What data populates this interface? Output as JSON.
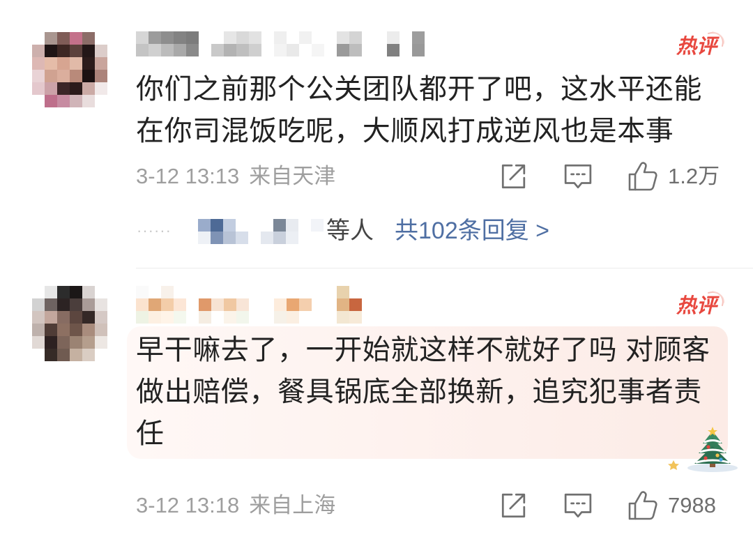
{
  "colors": {
    "text": "#222222",
    "meta": "#9e9e9e",
    "count": "#6e6e6e",
    "link": "#4f6fa3",
    "badge": "#e8483f",
    "divider": "#ececec",
    "icon": "#707070",
    "reply-suffix": "#444444",
    "ellipsis": "#c9c9c9",
    "panel-left": "#fff8f6",
    "panel-right": "#fcebe6"
  },
  "comments": [
    {
      "user": {
        "avatar_mosaic": [
          [
            "",
            "#a99690",
            "#7f5c57",
            "#c4718a",
            "#8c6d68",
            ""
          ],
          [
            "#cdb0ad",
            "#1f1515",
            "#3d2723",
            "#5c413c",
            "#231717",
            "#dccdca"
          ],
          [
            "#ddb8b4",
            "#e5bca8",
            "#d7a591",
            "#e1baa8",
            "#2c1c1b",
            "#c9a59c"
          ],
          [
            "#e9d3d6",
            "#d0a291",
            "#dbae9d",
            "#b98a7a",
            "#1b1111",
            "#ab837a"
          ],
          [
            "#e4c8cd",
            "#cca2a8",
            "#3c2527",
            "#2b1b1b",
            "#cbaaa5",
            "#f1e9e9"
          ],
          [
            "",
            "#be6f8b",
            "#c78ba1",
            "#d0b4b8",
            "#e9dddd",
            ""
          ]
        ],
        "name_mosaic": [
          [
            "#d6d6d6",
            "#9c9c9c",
            "#8e8e8e",
            "#838383",
            "#7c7c7c",
            "#ffffff",
            "#ffffff",
            "#e6e6e6",
            "#d9d9d9",
            "#e2e2e2",
            "#ffffff",
            "#efefef",
            "#ffffff",
            "#f1f1f1",
            "#ffffff",
            "#ffffff",
            "#e3e3e3",
            "#d4d4d4",
            "#ffffff",
            "#ffffff",
            "#ececec",
            "#ffffff",
            "#9d9d9d",
            "#ffffff"
          ],
          [
            "#c4c4c4",
            "#d0d0d0",
            "#bcbcbc",
            "#a9a9a9",
            "#8a8a8a",
            "#ffffff",
            "#c9c9c9",
            "#b3b3b3",
            "#bfbfbf",
            "#cfcfcf",
            "#ffffff",
            "#f3f3f3",
            "#e9e9e9",
            "#ffffff",
            "#f5f5f5",
            "#ffffff",
            "#9a9a9a",
            "#bdbdbd",
            "#ffffff",
            "#ffffff",
            "#808080",
            "#ffffff",
            "#999999",
            "#ffffff"
          ]
        ]
      },
      "badge": "热评",
      "text_lines": [
        "你们之前那个公关团队都开了吧，这水平还能",
        "在你司混饭吃呢，大顺风打成逆风也是本事"
      ],
      "time": "3-12 13:13",
      "location": "来自天津",
      "actions": {
        "share_icon": "share-icon",
        "comment_icon": "comment-icon",
        "like_icon": "like-icon",
        "likes": "1.2万"
      },
      "replies": {
        "ellipsis": "······",
        "names_mosaic": [
          [
            "#9aaccb",
            "#4e6a96",
            "#c2cde0",
            "#ffffff",
            "#ffffff",
            "#ffffff",
            "#7b8797",
            "#e8ebf0",
            "#ffffff",
            "#f2f4f8"
          ],
          [
            "#eef1f6",
            "#7f93b5",
            "#b8c3d6",
            "#d7deea",
            "#ffffff",
            "#e4e8ef",
            "#c9d0dc",
            "#eceff4",
            "#ffffff",
            "#ffffff"
          ]
        ],
        "suffix": "等人",
        "link": "共102条回复 >"
      }
    },
    {
      "user": {
        "avatar_mosaic": [
          [
            "",
            "#e6e6e6",
            "#2c2c2c",
            "#1b1717",
            "#d9d3d1",
            ""
          ],
          [
            "#d2d2d2",
            "#6e6361",
            "#2c2323",
            "#4b3e3c",
            "#aa9c98",
            "#e8e3e1"
          ],
          [
            "#d2c5c0",
            "#c3a79d",
            "#876c62",
            "#5c463f",
            "#342826",
            "#d5c9c5"
          ],
          [
            "#beb1ac",
            "#4f3c36",
            "#8d7062",
            "#6e554a",
            "#a98c7d",
            "#d0c1ba"
          ],
          [
            "#e1d9d5",
            "#2d2121",
            "#7d655a",
            "#9b8373",
            "#b59e8d",
            "#ede7e3"
          ],
          [
            "",
            "#362b27",
            "#705b51",
            "#c5b1a1",
            "#dacdc3",
            ""
          ]
        ],
        "name_mosaic": [
          [
            "#fafafa",
            "#ffffff",
            "#f8f1ea",
            "#ffffff",
            "#ffffff",
            "#ffffff",
            "#ffffff",
            "#ffffff",
            "#ffffff",
            "#ffffff",
            "#ffffff",
            "#ffffff",
            "#ffffff",
            "#ffffff",
            "#ffffff",
            "#ffffff",
            "#e8d2ad",
            "#ffffff"
          ],
          [
            "#fbe3cf",
            "#e0a776",
            "#f3cda9",
            "#fce6d6",
            "#ffffff",
            "#e0996a",
            "#f7e3d3",
            "#f0c8a2",
            "#f8e5d7",
            "#ffffff",
            "#ffffff",
            "#fdecdc",
            "#e9a772",
            "#f4cfae",
            "#ffffff",
            "#ffffff",
            "#e1b484",
            "#c8663f"
          ],
          [
            "#eef3e4",
            "#fdf0e2",
            "#fff4e8",
            "#f4f8ee",
            "#ffffff",
            "#f5ede2",
            "#ffffff",
            "#fbf4ea",
            "#f2f6ec",
            "#ffffff",
            "#ffffff",
            "#f6f1e8",
            "#fbefe2",
            "#ffffff",
            "#ffffff",
            "#ffffff",
            "#f3e7d2",
            "#f7ead8"
          ]
        ]
      },
      "badge": "热评",
      "decoration_icon": "christmas-tree-icon",
      "text_lines": [
        "早干嘛去了，一开始就这样不就好了吗 对顾客",
        "做出赔偿，餐具锅底全部换新，追究犯事者责",
        "任"
      ],
      "time": "3-12 13:18",
      "location": "来自上海",
      "actions": {
        "share_icon": "share-icon",
        "comment_icon": "comment-icon",
        "like_icon": "like-icon",
        "likes": "7988"
      }
    }
  ]
}
